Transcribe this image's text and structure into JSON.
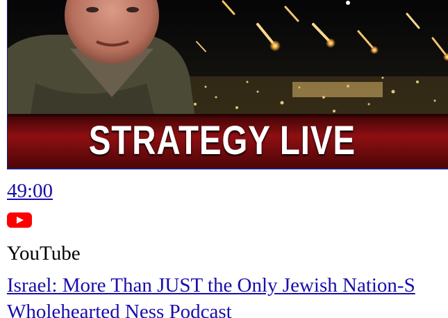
{
  "video": {
    "thumbnail_banner": "STRATEGY LIVE",
    "duration": "49:00",
    "platform_icon": "youtube-play-icon",
    "source": "YouTube",
    "title_line_1": "Israel: More Than JUST the Only Jewish Nation-S",
    "title_line_2": "Wholehearted Ness Podcast"
  },
  "colors": {
    "link": "#1a0dab",
    "youtube_red": "#ff0000",
    "banner_red": "#7a0a0c",
    "thumbnail_border": "#1b1f7a"
  }
}
